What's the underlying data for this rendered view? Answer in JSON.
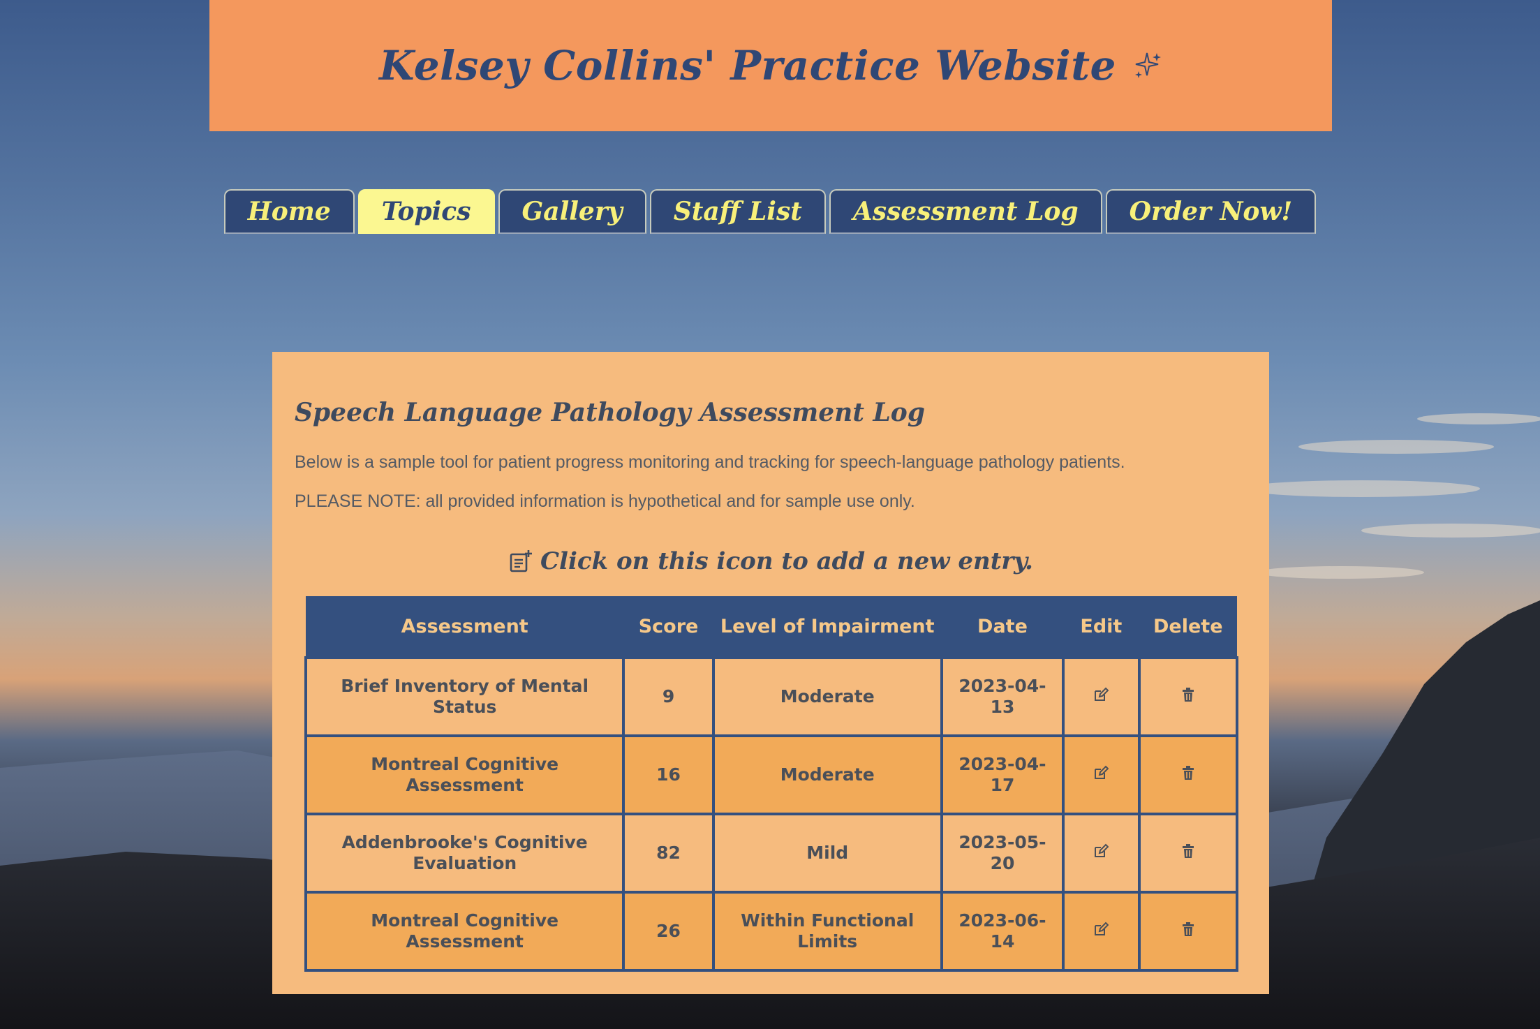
{
  "header": {
    "title": "Kelsey Collins' Practice Website",
    "icon": "sparkle-icon"
  },
  "nav": {
    "tabs": [
      {
        "label": "Home",
        "active": false
      },
      {
        "label": "Topics",
        "active": true
      },
      {
        "label": "Gallery",
        "active": false
      },
      {
        "label": "Staff List",
        "active": false
      },
      {
        "label": "Assessment Log",
        "active": false
      },
      {
        "label": "Order Now!",
        "active": false
      }
    ]
  },
  "main": {
    "title": "Speech Language Pathology Assessment Log",
    "intro": "Below is a sample tool for patient progress monitoring and tracking for speech-language pathology patients.",
    "note": "PLEASE NOTE: all provided information is hypothetical and for sample use only.",
    "add_entry_text": "Click on this icon to add a new entry.",
    "add_entry_icon": "add-note-icon"
  },
  "table": {
    "headers": [
      "Assessment",
      "Score",
      "Level of Impairment",
      "Date",
      "Edit",
      "Delete"
    ],
    "rows": [
      {
        "assessment": "Brief Inventory of Mental Status",
        "score": "9",
        "level": "Moderate",
        "date": "2023-04-13"
      },
      {
        "assessment": "Montreal Cognitive Assessment",
        "score": "16",
        "level": "Moderate",
        "date": "2023-04-17"
      },
      {
        "assessment": "Addenbrooke's Cognitive Evaluation",
        "score": "82",
        "level": "Mild",
        "date": "2023-05-20"
      },
      {
        "assessment": "Montreal Cognitive Assessment",
        "score": "26",
        "level": "Within Functional Limits",
        "date": "2023-06-14"
      }
    ],
    "edit_icon": "edit-icon",
    "delete_icon": "trash-icon"
  },
  "colors": {
    "header_bg": "#f4985d",
    "nav_bg": "#2f4775",
    "nav_text": "#f8f07a",
    "active_tab_bg": "#fbf791",
    "panel_bg": "#f6bb7e",
    "row_alt_bg": "#f2aa58",
    "table_header_bg": "#34507f"
  }
}
